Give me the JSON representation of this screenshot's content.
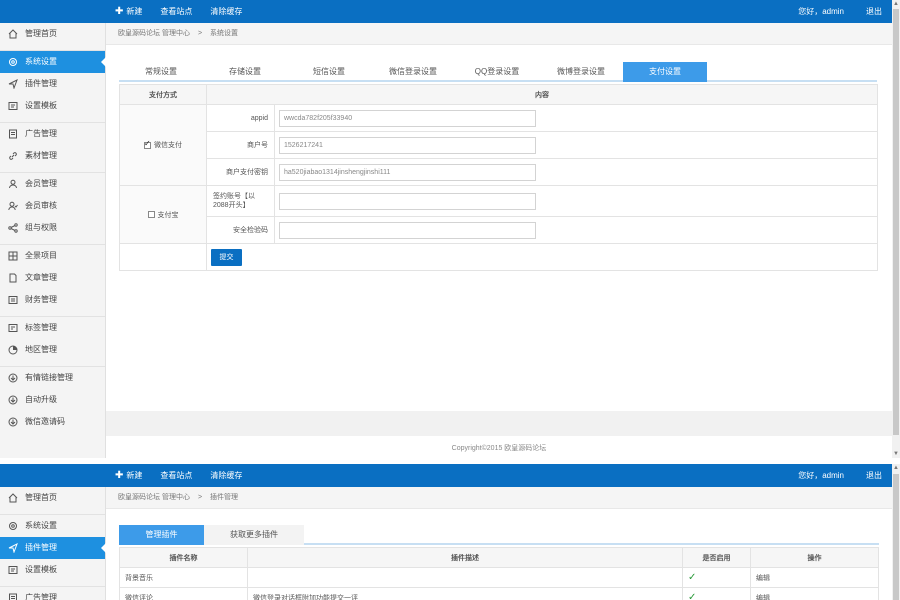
{
  "colors": {
    "topbar": "#0a6fc2",
    "active_nav": "#1e90e0",
    "active_tab": "#3d9be9",
    "check": "#2a9a3a"
  },
  "topbar": {
    "new_label": "新建",
    "view_site_label": "查看站点",
    "clear_cache_label": "清除缓存",
    "greeting": "您好，admin",
    "logout_label": "退出"
  },
  "sidebar": {
    "items": [
      {
        "label": "管理首页",
        "icon": "home-icon"
      },
      {
        "label": "系统设置",
        "icon": "gear-icon"
      },
      {
        "label": "插件管理",
        "icon": "send-icon"
      },
      {
        "label": "设置模板",
        "icon": "template-icon"
      },
      {
        "label": "广告管理",
        "icon": "ad-icon"
      },
      {
        "label": "素材管理",
        "icon": "link-icon"
      },
      {
        "label": "会员管理",
        "icon": "user-icon"
      },
      {
        "label": "会员审核",
        "icon": "user-check-icon"
      },
      {
        "label": "组与权限",
        "icon": "share-icon"
      },
      {
        "label": "全景项目",
        "icon": "grid-icon"
      },
      {
        "label": "文章管理",
        "icon": "document-icon"
      },
      {
        "label": "财务管理",
        "icon": "finance-icon"
      },
      {
        "label": "标签管理",
        "icon": "tag-icon"
      },
      {
        "label": "地区管理",
        "icon": "region-icon"
      },
      {
        "label": "有情链接管理",
        "icon": "download-icon"
      },
      {
        "label": "自动升级",
        "icon": "upgrade-icon"
      },
      {
        "label": "微信邀请码",
        "icon": "invite-icon"
      }
    ]
  },
  "screen1": {
    "breadcrumb": {
      "root": "欧皇源码论坛 管理中心",
      "sep": ">",
      "current": "系统设置"
    },
    "tabs": [
      "常规设置",
      "存储设置",
      "短信设置",
      "微信登录设置",
      "QQ登录设置",
      "微博登录设置",
      "支付设置"
    ],
    "table": {
      "col_method": "支付方式",
      "col_content": "内容",
      "wechat": {
        "label": "微信支付",
        "checked": true,
        "fields": [
          {
            "label": "appid",
            "value": "wwcda782f205f33940"
          },
          {
            "label": "商户号",
            "value": "1526217241"
          },
          {
            "label": "商户支付密钥",
            "value": "ha520jiabao1314jinshengjinshi111"
          }
        ]
      },
      "alipay": {
        "label": "支付宝",
        "checked": false,
        "fields": [
          {
            "label": "签约账号【以2088开头】",
            "value": ""
          },
          {
            "label": "安全检验码",
            "value": ""
          }
        ]
      },
      "submit_label": "提交"
    },
    "copyright": "Copyright©2015    欧皇源码论坛"
  },
  "screen2": {
    "breadcrumb": {
      "root": "欧皇源码论坛 管理中心",
      "sep": ">",
      "current": "插件管理"
    },
    "tabs": [
      "管理插件",
      "获取更多插件"
    ],
    "table": {
      "headers": [
        "插件名称",
        "插件描述",
        "是否启用",
        "操作"
      ],
      "rows": [
        {
          "name": "背景音乐",
          "desc": "",
          "enabled": "✓",
          "action": "编辑"
        },
        {
          "name": "微信评论",
          "desc": "微信登录对话框附加功能提交一评",
          "enabled": "✓",
          "action": "编辑"
        }
      ]
    }
  }
}
